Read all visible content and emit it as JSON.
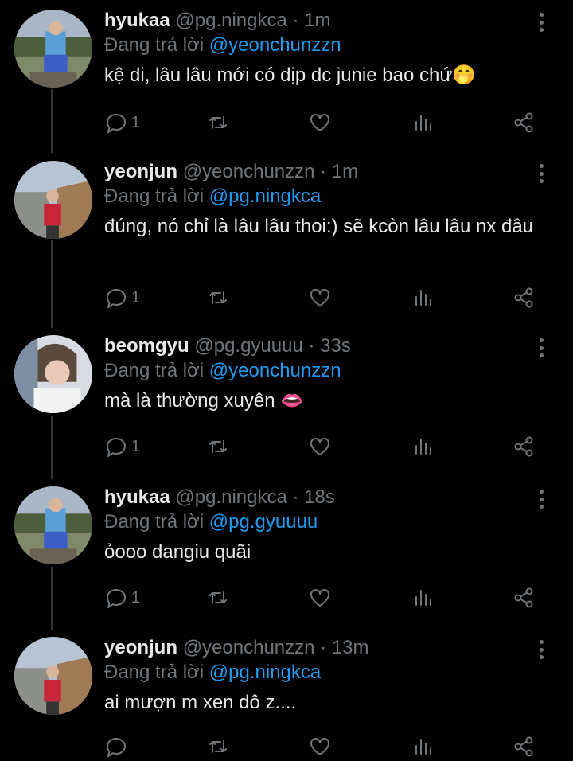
{
  "colors": {
    "background": "#000000",
    "text": "#e7e9ea",
    "muted": "#71767b",
    "mention": "#1d9bf0"
  },
  "reply_prefix": "Đang trả lời",
  "tweets": [
    {
      "name": "hyukaa",
      "handle": "@pg.ningkca",
      "dot": "·",
      "time": "1m",
      "reply_to": "@yeonchunzzn",
      "text": "kệ di, lâu lâu mới có dịp dc junie bao chứ🤭",
      "reply_count": "1",
      "icons": [
        "reply-icon",
        "retweet-icon",
        "like-icon",
        "views-icon",
        "share-icon",
        "more-icon"
      ]
    },
    {
      "name": "yeonjun",
      "handle": "@yeonchunzzn",
      "dot": "·",
      "time": "1m",
      "reply_to": "@pg.ningkca",
      "text": "đúng, nó chỉ là lâu lâu thoi:) sẽ kcòn lâu lâu nx đâu",
      "reply_count": "1"
    },
    {
      "name": "beomgyu",
      "handle": "@pg.gyuuuu",
      "dot": "·",
      "time": "33s",
      "reply_to": "@yeonchunzzn",
      "text": "mà là thường xuyên 👄",
      "reply_count": "1"
    },
    {
      "name": "hyukaa",
      "handle": "@pg.ningkca",
      "dot": "·",
      "time": "18s",
      "reply_to": "@pg.gyuuuu",
      "text": "ỏooo dangiu quãi",
      "reply_count": "1"
    },
    {
      "name": "yeonjun",
      "handle": "@yeonchunzzn",
      "dot": "·",
      "time": "13m",
      "reply_to": "@pg.ningkca",
      "text": "ai mượn m xen dô z....",
      "reply_count": ""
    }
  ]
}
